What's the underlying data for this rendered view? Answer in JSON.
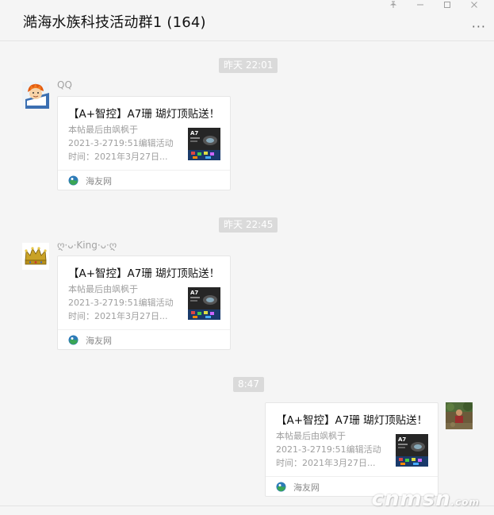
{
  "window": {
    "title": "澔海水族科技活动群1 (164)",
    "controls": [
      "pin-icon",
      "minimize-icon",
      "maximize-icon",
      "close-icon"
    ],
    "more_label": "···"
  },
  "colors": {
    "background": "#f5f5f5",
    "timestamp_bg": "#dadada",
    "card_bg": "#ffffff",
    "muted_text": "#9f9f9f"
  },
  "messages": [
    {
      "timestamp": "昨天 22:01",
      "sender": "QQ",
      "avatar": "cartoon-avatar",
      "card": {
        "title": "【A+智控】A7珊 瑚灯顶贴送！",
        "desc": [
          "本帖最后由飒枫于",
          "2021-3-2719:51编辑活动",
          "时间：2021年3月27日..."
        ],
        "source": "海友网"
      }
    },
    {
      "timestamp": "昨天 22:45",
      "sender": "ღ·ᴗ·King·ᴗ·ღ",
      "avatar": "crown-avatar",
      "card": {
        "title": "【A+智控】A7珊 瑚灯顶贴送！",
        "desc": [
          "本帖最后由飒枫于",
          "2021-3-2719:51编辑活动",
          "时间：2021年3月27日..."
        ],
        "source": "海友网"
      }
    },
    {
      "timestamp": "8:47",
      "sender": "",
      "avatar": "photo-avatar",
      "card": {
        "title": "【A+智控】A7珊 瑚灯顶贴送！",
        "desc": [
          "本帖最后由飒枫于",
          "2021-3-2719:51编辑活动",
          "时间：2021年3月27日..."
        ],
        "source": "海友网"
      }
    }
  ],
  "watermark": {
    "main": "cnmsn",
    "suffix": ".com"
  }
}
